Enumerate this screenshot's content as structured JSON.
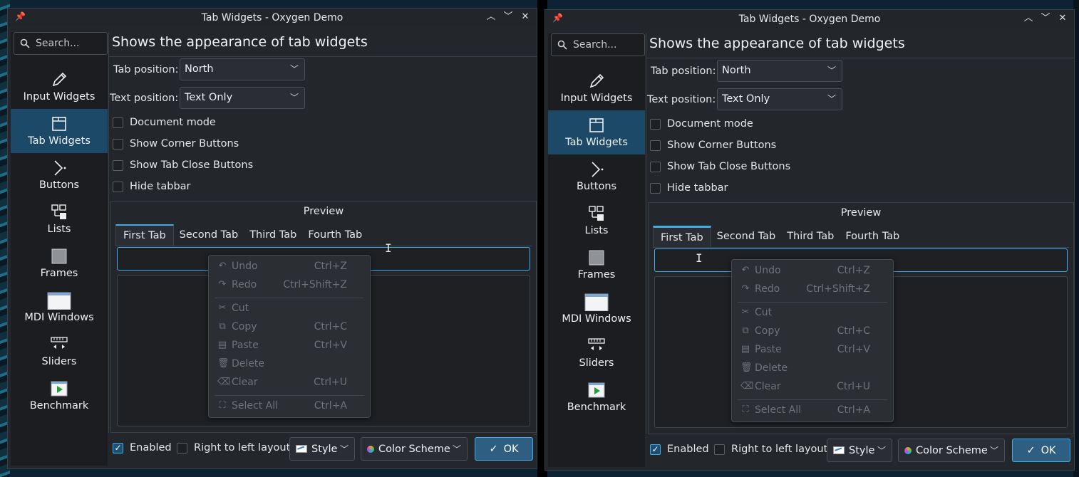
{
  "window": {
    "title": "Tab Widgets - Oxygen Demo",
    "icons": {
      "pin": "pin-icon",
      "minimize": "chevron-up-icon",
      "maximize": "chevron-down-icon",
      "close": "close-icon"
    }
  },
  "search": {
    "placeholder": "Search..."
  },
  "sidebar": {
    "items": [
      {
        "label": "Input Widgets",
        "icon": "pencil-icon"
      },
      {
        "label": "Tab Widgets",
        "icon": "tab-icon"
      },
      {
        "label": "Buttons",
        "icon": "cursor-icon"
      },
      {
        "label": "Lists",
        "icon": "list-icon"
      },
      {
        "label": "Frames",
        "icon": "frame-icon"
      },
      {
        "label": "MDI Windows",
        "icon": "window-icon"
      },
      {
        "label": "Sliders",
        "icon": "slider-icon"
      },
      {
        "label": "Benchmark",
        "icon": "play-icon"
      }
    ]
  },
  "page": {
    "title": "Shows the appearance of tab widgets",
    "tab_position_label": "Tab position:",
    "tab_position_value": "North",
    "text_position_label": "Text position:",
    "text_position_value": "Text Only",
    "checkboxes": [
      "Document mode",
      "Show Corner Buttons",
      "Show Tab Close Buttons",
      "Hide tabbar"
    ]
  },
  "preview": {
    "title": "Preview",
    "tabs": [
      "First Tab",
      "Second Tab",
      "Third Tab",
      "Fourth Tab"
    ]
  },
  "context_menu": {
    "items": [
      {
        "label": "Undo",
        "shortcut": "Ctrl+Z",
        "icon": "undo-icon",
        "enabled": false
      },
      {
        "label": "Redo",
        "shortcut": "Ctrl+Shift+Z",
        "icon": "redo-icon",
        "enabled": false
      },
      {
        "label": "Cut",
        "shortcut": "",
        "icon": "scissors-icon",
        "enabled": false
      },
      {
        "label": "Copy",
        "shortcut": "Ctrl+C",
        "icon": "copy-icon",
        "enabled": false
      },
      {
        "label": "Paste",
        "shortcut": "Ctrl+V",
        "icon": "paste-icon",
        "enabled": false
      },
      {
        "label": "Delete",
        "shortcut": "",
        "icon": "trash-icon",
        "enabled": false
      },
      {
        "label": "Clear",
        "shortcut": "Ctrl+U",
        "icon": "clear-icon",
        "enabled": false
      },
      {
        "label": "Select All",
        "shortcut": "Ctrl+A",
        "icon": "select-all-icon",
        "enabled": false
      }
    ]
  },
  "footer": {
    "enabled_label": "Enabled",
    "enabled_checked": true,
    "rtl_label": "Right to left layout",
    "rtl_checked": false,
    "style_label": "Style",
    "color_scheme_label": "Color Scheme",
    "ok_label": "OK"
  },
  "colors": {
    "accent": "#3daee9",
    "selection": "#1d4968",
    "background": "#23262b"
  }
}
